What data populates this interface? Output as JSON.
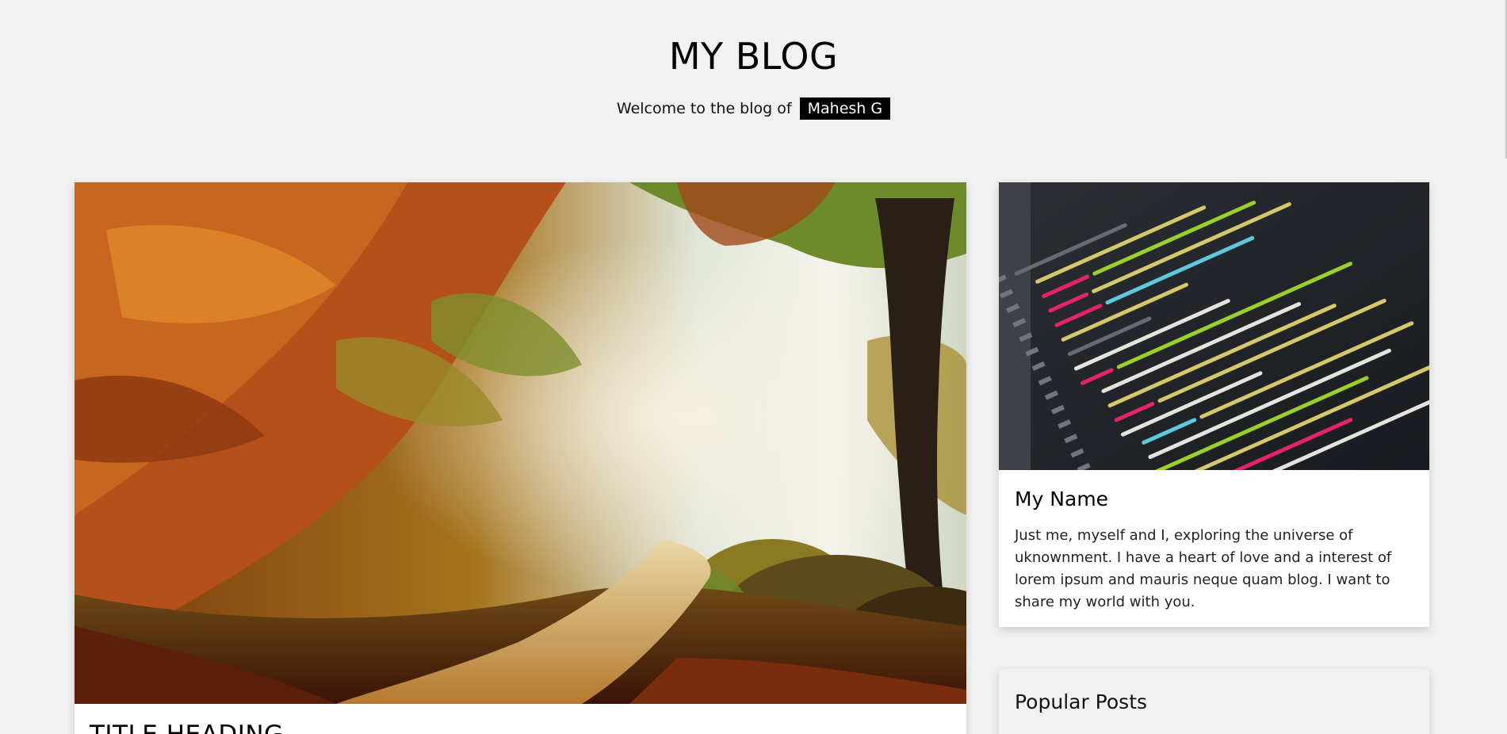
{
  "header": {
    "title": "MY BLOG",
    "tagline": "Welcome to the blog of",
    "author_name": "Mahesh G"
  },
  "main_post": {
    "image_alt": "Autumn forest path",
    "title": "TITLE HEADING"
  },
  "about": {
    "image_alt": "Code on screen",
    "name": "My Name",
    "text": "Just me, myself and I, exploring the universe of uknownment. I have a heart of love and a interest of lorem ipsum and mauris neque quam blog. I want to share my world with you."
  },
  "popular_posts": {
    "title": "Popular Posts"
  }
}
